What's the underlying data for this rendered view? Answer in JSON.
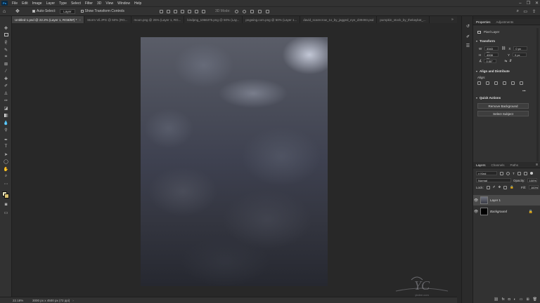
{
  "app": {
    "logo": "Ps"
  },
  "menu": [
    "File",
    "Edit",
    "Image",
    "Layer",
    "Type",
    "Select",
    "Filter",
    "3D",
    "View",
    "Window",
    "Help"
  ],
  "window_controls": [
    "–",
    "❐",
    "✕"
  ],
  "options": {
    "auto_select_label": "Auto-Select:",
    "auto_select_value": "Layer",
    "show_transform_label": "Show Transform Controls",
    "mode_3d": "3D Mode:"
  },
  "tabs": [
    {
      "label": "Untitled-1.psd @ 22.2% (Layer 1, RGB/8#) *",
      "active": true
    },
    {
      "label": "Storm Vil.JPG @ 50% (RG...",
      "active": false
    },
    {
      "label": "moon.png @ 25% (Layer 1, RG...",
      "active": false
    },
    {
      "label": "kindpng_1066375.png @ 50% (Lay...",
      "active": false
    },
    {
      "label": "pngwing.com.png @ 50% (Layer 1...",
      "active": false
    },
    {
      "label": "david_scarecrow_1s_by_jagged_eye_d39493.psd",
      "active": false
    },
    {
      "label": "pumpkin_stock_by_thekaykat_...",
      "active": false
    }
  ],
  "status": {
    "zoom": "22.18%",
    "info": "3000 px x 4500 px (72 ppi)"
  },
  "properties": {
    "tabs": [
      "Properties",
      "Adjustments"
    ],
    "layer_type": "Pixel Layer",
    "transform_title": "Transform",
    "w_label": "W",
    "w_value": "3343 px",
    "h_label": "H",
    "h_value": "4008 px",
    "x_label": "X",
    "x_value": "0 px",
    "y_label": "Y",
    "y_value": "0 px",
    "angle_value": "0.00°",
    "align_title": "Align and Distribute",
    "align_label": "Align:",
    "more": "•••",
    "quick_title": "Quick Actions",
    "remove_bg": "Remove Background",
    "select_subject": "Select Subject"
  },
  "layers_panel": {
    "tabs": [
      "Layers",
      "Channels",
      "Paths"
    ],
    "filter": "Kind",
    "blend_mode": "Normal",
    "opacity_label": "Opacity:",
    "opacity_value": "100%",
    "lock_label": "Lock:",
    "fill_label": "Fill:",
    "fill_value": "100%",
    "layers": [
      {
        "name": "Layer 1",
        "selected": true
      },
      {
        "name": "Background",
        "selected": false
      }
    ]
  },
  "watermark": {
    "text": "ybdee.com"
  },
  "colors": {
    "accent": "#31a8ff",
    "panel": "#323232",
    "canvas_bg": "#282828",
    "fg_swatch": "#e8e4c0",
    "bg_swatch": "#d8c070"
  }
}
